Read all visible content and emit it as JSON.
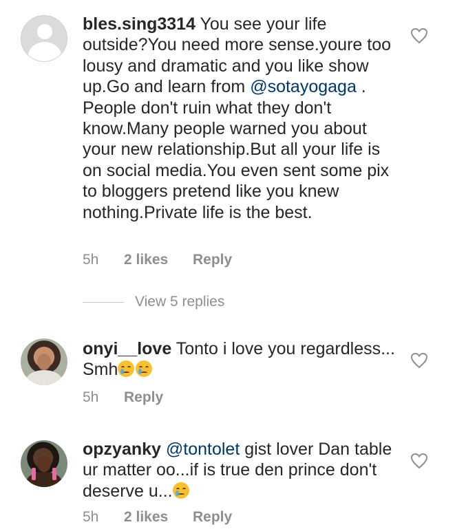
{
  "comments": [
    {
      "username": "bles.sing3314",
      "text_before": " You see your life outside?You need more sense.youre too lousy and dramatic and you like show up.Go and learn from ",
      "mention": "@sotayogaga",
      "text_after": " . People don't ruin what they don't know.Many people warned you about your new relationship.But all your life is on social media.You even sent some pix to bloggers pretend like you knew nothing.Private life is the best.",
      "time": "5h",
      "likes": "2 likes",
      "reply": "Reply",
      "view_replies": "View 5 replies"
    },
    {
      "username": "onyi__love",
      "text": " Tonto i love you regardless... Smh",
      "emoji_count": 2,
      "time": "5h",
      "reply": "Reply"
    },
    {
      "username": "opzyanky",
      "mention": "@tontolet",
      "text": "  gist lover Dan table ur matter oo...if is true den prince don't deserve u...",
      "emoji_count": 1,
      "time": "5h",
      "likes": "2 likes",
      "reply": "Reply"
    }
  ],
  "icons": {
    "like": "heart-outline-icon",
    "emoji": "crying-face-emoji"
  },
  "colors": {
    "text": "#262626",
    "meta": "#8e8e8e",
    "mention": "#00376b",
    "heart": "#8e8e8e"
  }
}
